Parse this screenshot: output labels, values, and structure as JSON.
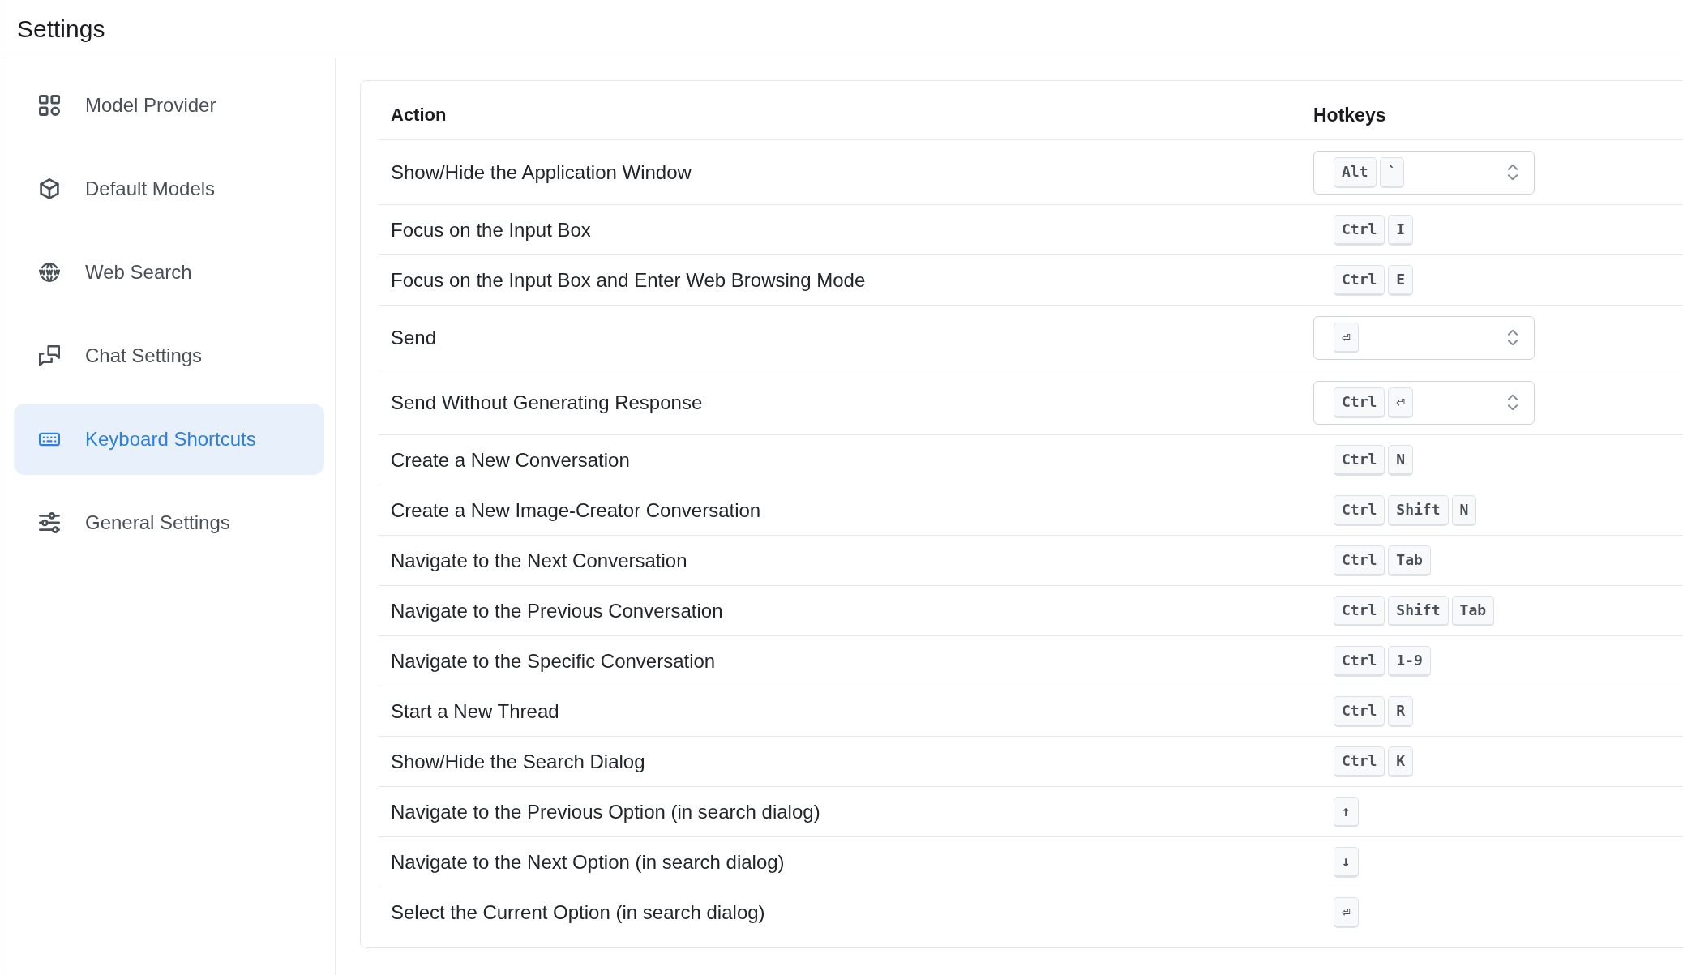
{
  "window": {
    "title": "Settings"
  },
  "sidebar": {
    "items": [
      {
        "label": "Model Provider",
        "selected": false
      },
      {
        "label": "Default Models",
        "selected": false
      },
      {
        "label": "Web Search",
        "selected": false
      },
      {
        "label": "Chat Settings",
        "selected": false
      },
      {
        "label": "Keyboard Shortcuts",
        "selected": true
      },
      {
        "label": "General Settings",
        "selected": false
      }
    ]
  },
  "table": {
    "columns": [
      "Action",
      "Hotkeys"
    ],
    "rows": [
      {
        "action": "Show/Hide the Application Window",
        "kind": "select",
        "keys": [
          "Alt",
          "`"
        ]
      },
      {
        "action": "Focus on the Input Box",
        "kind": "keys",
        "keys": [
          "Ctrl",
          "I"
        ]
      },
      {
        "action": "Focus on the Input Box and Enter Web Browsing Mode",
        "kind": "keys",
        "keys": [
          "Ctrl",
          "E"
        ]
      },
      {
        "action": "Send",
        "kind": "select",
        "keys": [
          "⏎"
        ]
      },
      {
        "action": "Send Without Generating Response",
        "kind": "select",
        "keys": [
          "Ctrl",
          "⏎"
        ]
      },
      {
        "action": "Create a New Conversation",
        "kind": "keys",
        "keys": [
          "Ctrl",
          "N"
        ]
      },
      {
        "action": "Create a New Image-Creator Conversation",
        "kind": "keys",
        "keys": [
          "Ctrl",
          "Shift",
          "N"
        ]
      },
      {
        "action": "Navigate to the Next Conversation",
        "kind": "keys",
        "keys": [
          "Ctrl",
          "Tab"
        ]
      },
      {
        "action": "Navigate to the Previous Conversation",
        "kind": "keys",
        "keys": [
          "Ctrl",
          "Shift",
          "Tab"
        ]
      },
      {
        "action": "Navigate to the Specific Conversation",
        "kind": "keys",
        "keys": [
          "Ctrl",
          "1-9"
        ]
      },
      {
        "action": "Start a New Thread",
        "kind": "keys",
        "keys": [
          "Ctrl",
          "R"
        ]
      },
      {
        "action": "Show/Hide the Search Dialog",
        "kind": "keys",
        "keys": [
          "Ctrl",
          "K"
        ]
      },
      {
        "action": "Navigate to the Previous Option (in search dialog)",
        "kind": "keys",
        "keys": [
          "↑"
        ]
      },
      {
        "action": "Navigate to the Next Option (in search dialog)",
        "kind": "keys",
        "keys": [
          "↓"
        ]
      },
      {
        "action": "Select the Current Option (in search dialog)",
        "kind": "keys",
        "keys": [
          "⏎"
        ]
      }
    ]
  }
}
